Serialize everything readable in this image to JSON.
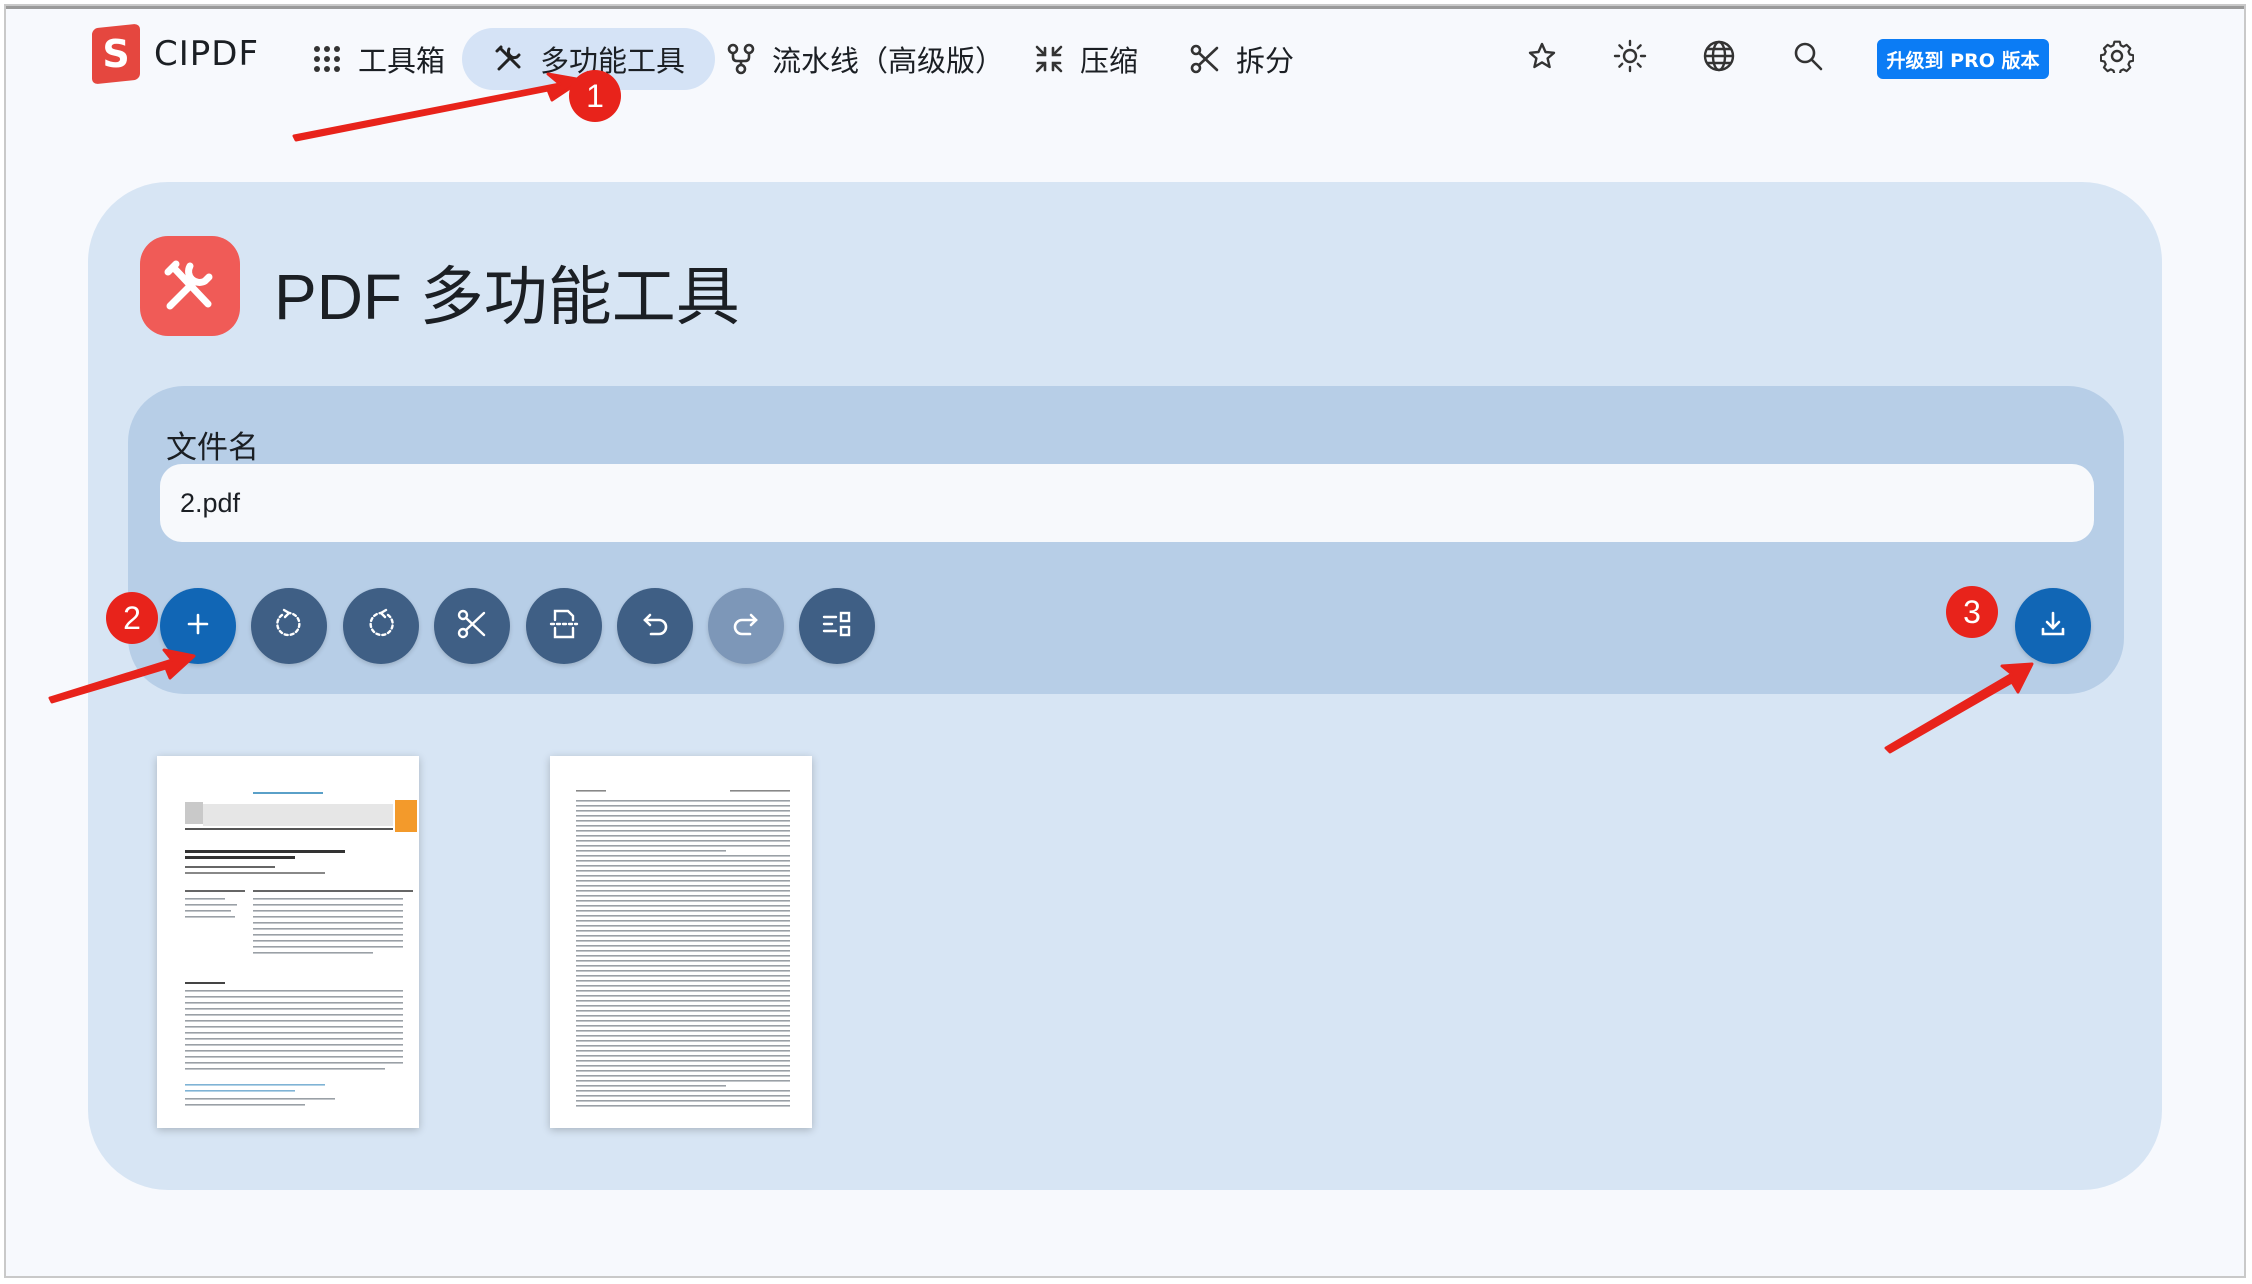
{
  "app": {
    "logo_letter": "S",
    "name": "CIPDF"
  },
  "nav": {
    "toolbox": "工具箱",
    "multitool": "多功能工具",
    "pipeline": "流水线（高级版）",
    "compress": "压缩",
    "split": "拆分"
  },
  "header_icons": [
    "star-icon",
    "sun-icon",
    "globe-icon",
    "search-icon",
    "gear-icon"
  ],
  "pro_badge": "升级到 PRO 版本",
  "page": {
    "title": "PDF 多功能工具"
  },
  "file": {
    "label": "文件名",
    "value": "2.pdf"
  },
  "toolbar_icons": [
    "plus-icon",
    "rotate-left-icon",
    "rotate-right-icon",
    "scissors-icon",
    "split-page-icon",
    "undo-icon",
    "redo-icon",
    "layout-icon",
    "download-icon"
  ],
  "annotations": {
    "m1": "1",
    "m2": "2",
    "m3": "3"
  },
  "thumbnails": {
    "page1": {
      "journal": "Journal of Econometrics",
      "title": "Estimation and variable selection for high-dimensional spatial dynamic panel data models"
    }
  },
  "colors": {
    "accent_blue": "#1166b5",
    "toolbar_button": "#3f5f85",
    "title_icon": "#f05b57",
    "pro_badge": "#0b7cf5",
    "annotation_red": "#e8231b"
  }
}
